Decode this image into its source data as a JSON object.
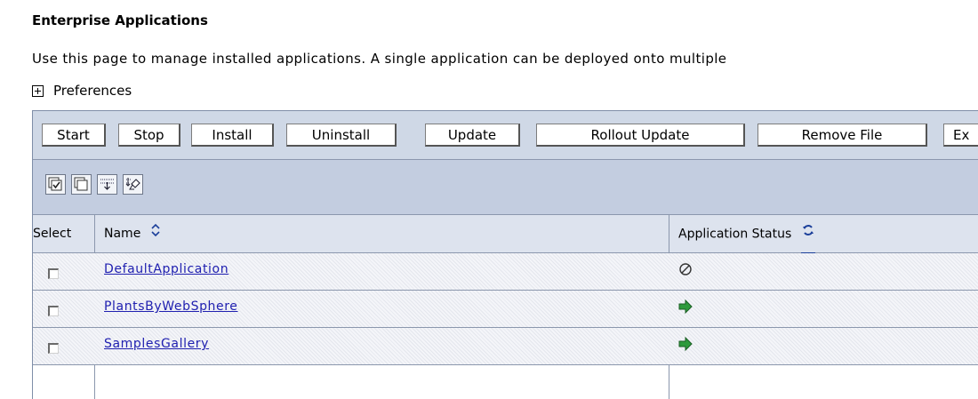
{
  "page": {
    "title": "Enterprise Applications",
    "description": "Use this page to manage installed applications. A single application can be deployed onto multiple",
    "preferences_label": "Preferences"
  },
  "toolbar": {
    "start": "Start",
    "stop": "Stop",
    "install": "Install",
    "uninstall": "Uninstall",
    "update": "Update",
    "rollout_update": "Rollout Update",
    "remove_file": "Remove File",
    "export": "Ex"
  },
  "icon_toolbar": {
    "icons": [
      "select-all-icon",
      "deselect-all-icon",
      "show-filter-icon",
      "clear-filter-icon"
    ]
  },
  "table": {
    "headers": {
      "select": "Select",
      "name": "Name",
      "status": "Application Status"
    },
    "rows": [
      {
        "name": "DefaultApplication",
        "status": "stopped",
        "status_icon": "stopped-icon"
      },
      {
        "name": "PlantsByWebSphere",
        "status": "started",
        "status_icon": "started-arrow-icon"
      },
      {
        "name": "SamplesGallery",
        "status": "started",
        "status_icon": "started-arrow-icon"
      }
    ]
  },
  "colors": {
    "link": "#2020b0",
    "started": "#2e9a3c",
    "toolbar_bg": "#cfd8e6",
    "header_bg": "#dde3ee"
  }
}
